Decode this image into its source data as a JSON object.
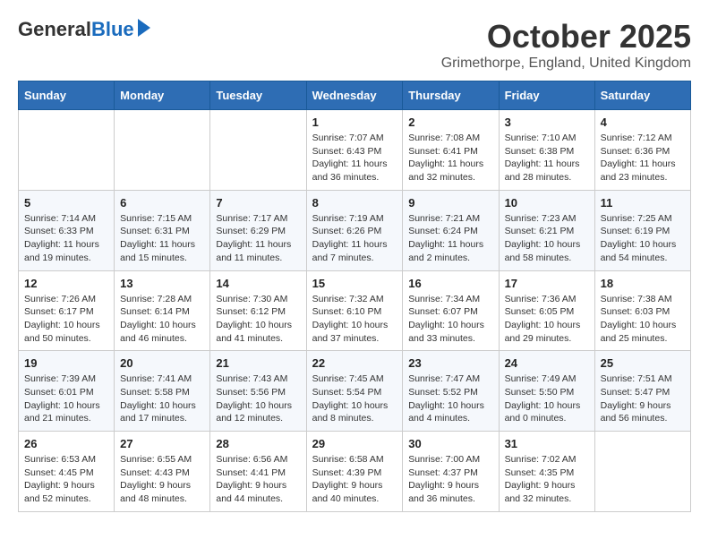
{
  "logo": {
    "general": "General",
    "blue": "Blue"
  },
  "title": {
    "month": "October 2025",
    "location": "Grimethorpe, England, United Kingdom"
  },
  "headers": [
    "Sunday",
    "Monday",
    "Tuesday",
    "Wednesday",
    "Thursday",
    "Friday",
    "Saturday"
  ],
  "weeks": [
    [
      {
        "day": "",
        "info": ""
      },
      {
        "day": "",
        "info": ""
      },
      {
        "day": "",
        "info": ""
      },
      {
        "day": "1",
        "info": "Sunrise: 7:07 AM\nSunset: 6:43 PM\nDaylight: 11 hours\nand 36 minutes."
      },
      {
        "day": "2",
        "info": "Sunrise: 7:08 AM\nSunset: 6:41 PM\nDaylight: 11 hours\nand 32 minutes."
      },
      {
        "day": "3",
        "info": "Sunrise: 7:10 AM\nSunset: 6:38 PM\nDaylight: 11 hours\nand 28 minutes."
      },
      {
        "day": "4",
        "info": "Sunrise: 7:12 AM\nSunset: 6:36 PM\nDaylight: 11 hours\nand 23 minutes."
      }
    ],
    [
      {
        "day": "5",
        "info": "Sunrise: 7:14 AM\nSunset: 6:33 PM\nDaylight: 11 hours\nand 19 minutes."
      },
      {
        "day": "6",
        "info": "Sunrise: 7:15 AM\nSunset: 6:31 PM\nDaylight: 11 hours\nand 15 minutes."
      },
      {
        "day": "7",
        "info": "Sunrise: 7:17 AM\nSunset: 6:29 PM\nDaylight: 11 hours\nand 11 minutes."
      },
      {
        "day": "8",
        "info": "Sunrise: 7:19 AM\nSunset: 6:26 PM\nDaylight: 11 hours\nand 7 minutes."
      },
      {
        "day": "9",
        "info": "Sunrise: 7:21 AM\nSunset: 6:24 PM\nDaylight: 11 hours\nand 2 minutes."
      },
      {
        "day": "10",
        "info": "Sunrise: 7:23 AM\nSunset: 6:21 PM\nDaylight: 10 hours\nand 58 minutes."
      },
      {
        "day": "11",
        "info": "Sunrise: 7:25 AM\nSunset: 6:19 PM\nDaylight: 10 hours\nand 54 minutes."
      }
    ],
    [
      {
        "day": "12",
        "info": "Sunrise: 7:26 AM\nSunset: 6:17 PM\nDaylight: 10 hours\nand 50 minutes."
      },
      {
        "day": "13",
        "info": "Sunrise: 7:28 AM\nSunset: 6:14 PM\nDaylight: 10 hours\nand 46 minutes."
      },
      {
        "day": "14",
        "info": "Sunrise: 7:30 AM\nSunset: 6:12 PM\nDaylight: 10 hours\nand 41 minutes."
      },
      {
        "day": "15",
        "info": "Sunrise: 7:32 AM\nSunset: 6:10 PM\nDaylight: 10 hours\nand 37 minutes."
      },
      {
        "day": "16",
        "info": "Sunrise: 7:34 AM\nSunset: 6:07 PM\nDaylight: 10 hours\nand 33 minutes."
      },
      {
        "day": "17",
        "info": "Sunrise: 7:36 AM\nSunset: 6:05 PM\nDaylight: 10 hours\nand 29 minutes."
      },
      {
        "day": "18",
        "info": "Sunrise: 7:38 AM\nSunset: 6:03 PM\nDaylight: 10 hours\nand 25 minutes."
      }
    ],
    [
      {
        "day": "19",
        "info": "Sunrise: 7:39 AM\nSunset: 6:01 PM\nDaylight: 10 hours\nand 21 minutes."
      },
      {
        "day": "20",
        "info": "Sunrise: 7:41 AM\nSunset: 5:58 PM\nDaylight: 10 hours\nand 17 minutes."
      },
      {
        "day": "21",
        "info": "Sunrise: 7:43 AM\nSunset: 5:56 PM\nDaylight: 10 hours\nand 12 minutes."
      },
      {
        "day": "22",
        "info": "Sunrise: 7:45 AM\nSunset: 5:54 PM\nDaylight: 10 hours\nand 8 minutes."
      },
      {
        "day": "23",
        "info": "Sunrise: 7:47 AM\nSunset: 5:52 PM\nDaylight: 10 hours\nand 4 minutes."
      },
      {
        "day": "24",
        "info": "Sunrise: 7:49 AM\nSunset: 5:50 PM\nDaylight: 10 hours\nand 0 minutes."
      },
      {
        "day": "25",
        "info": "Sunrise: 7:51 AM\nSunset: 5:47 PM\nDaylight: 9 hours\nand 56 minutes."
      }
    ],
    [
      {
        "day": "26",
        "info": "Sunrise: 6:53 AM\nSunset: 4:45 PM\nDaylight: 9 hours\nand 52 minutes."
      },
      {
        "day": "27",
        "info": "Sunrise: 6:55 AM\nSunset: 4:43 PM\nDaylight: 9 hours\nand 48 minutes."
      },
      {
        "day": "28",
        "info": "Sunrise: 6:56 AM\nSunset: 4:41 PM\nDaylight: 9 hours\nand 44 minutes."
      },
      {
        "day": "29",
        "info": "Sunrise: 6:58 AM\nSunset: 4:39 PM\nDaylight: 9 hours\nand 40 minutes."
      },
      {
        "day": "30",
        "info": "Sunrise: 7:00 AM\nSunset: 4:37 PM\nDaylight: 9 hours\nand 36 minutes."
      },
      {
        "day": "31",
        "info": "Sunrise: 7:02 AM\nSunset: 4:35 PM\nDaylight: 9 hours\nand 32 minutes."
      },
      {
        "day": "",
        "info": ""
      }
    ]
  ]
}
